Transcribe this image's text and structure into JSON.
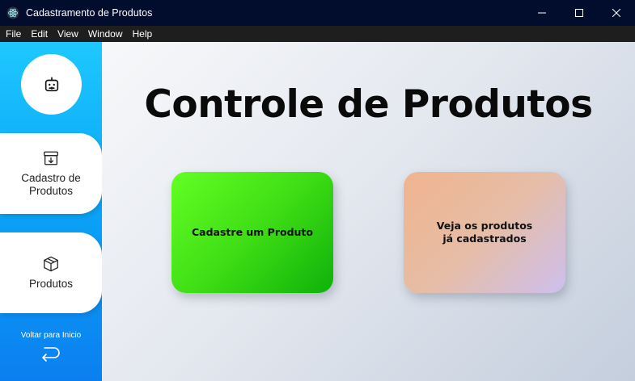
{
  "window": {
    "title": "Cadastramento de Produtos",
    "app_icon": "electron-atom-icon",
    "controls": [
      "minimize-icon",
      "maximize-icon",
      "close-icon"
    ]
  },
  "menu": {
    "items": [
      "File",
      "Edit",
      "View",
      "Window",
      "Help"
    ]
  },
  "sidebar": {
    "logo_icon": "robot-icon",
    "items": [
      {
        "icon": "archive-download-icon",
        "label": "Cadastro de\nProdutos"
      },
      {
        "icon": "package-icon",
        "label": "Produtos"
      }
    ],
    "back": {
      "label": "Voltar para Inicio",
      "icon": "return-arrow-icon"
    }
  },
  "main": {
    "title": "Controle de Produtos",
    "cards": [
      {
        "label": "Cadastre um Produto",
        "color": "#3fde15"
      },
      {
        "label": "Veja os produtos\njá cadastrados",
        "color": "#e6bda6"
      }
    ]
  },
  "colors": {
    "titlebar": "#020c2c",
    "menubar": "#1e1e1e",
    "sidebar_accent": "#0aa6f7"
  }
}
